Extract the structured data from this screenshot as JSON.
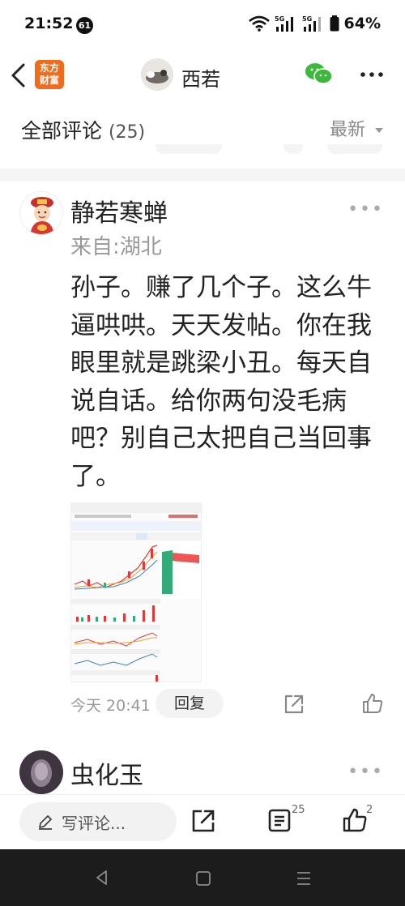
{
  "status": {
    "time": "21:52",
    "badge": "61",
    "battery": "64%"
  },
  "header": {
    "logo_line1": "东方",
    "logo_line2": "财富",
    "title": "西若"
  },
  "comments_header": {
    "title": "全部评论",
    "count": "(25)",
    "sort": "最新"
  },
  "comment": {
    "author": "静若寒蝉",
    "location": "来自:湖北",
    "text": "孙子。赚了几个子。这么牛逼哄哄。天天发帖。你在我眼里就是跳梁小丑。每天自说自话。给你两句没毛病吧？别自己太把自己当回事了。",
    "time": "今天 20:41",
    "reply_label": "回复",
    "more": "•••"
  },
  "next_comment": {
    "author": "虫化玉",
    "more": "•••"
  },
  "bottom_bar": {
    "input_placeholder": "写评论...",
    "comment_count": "25",
    "like_count": "2"
  },
  "colors": {
    "brand": "#f26b1d",
    "wechat": "#3cb93a"
  }
}
